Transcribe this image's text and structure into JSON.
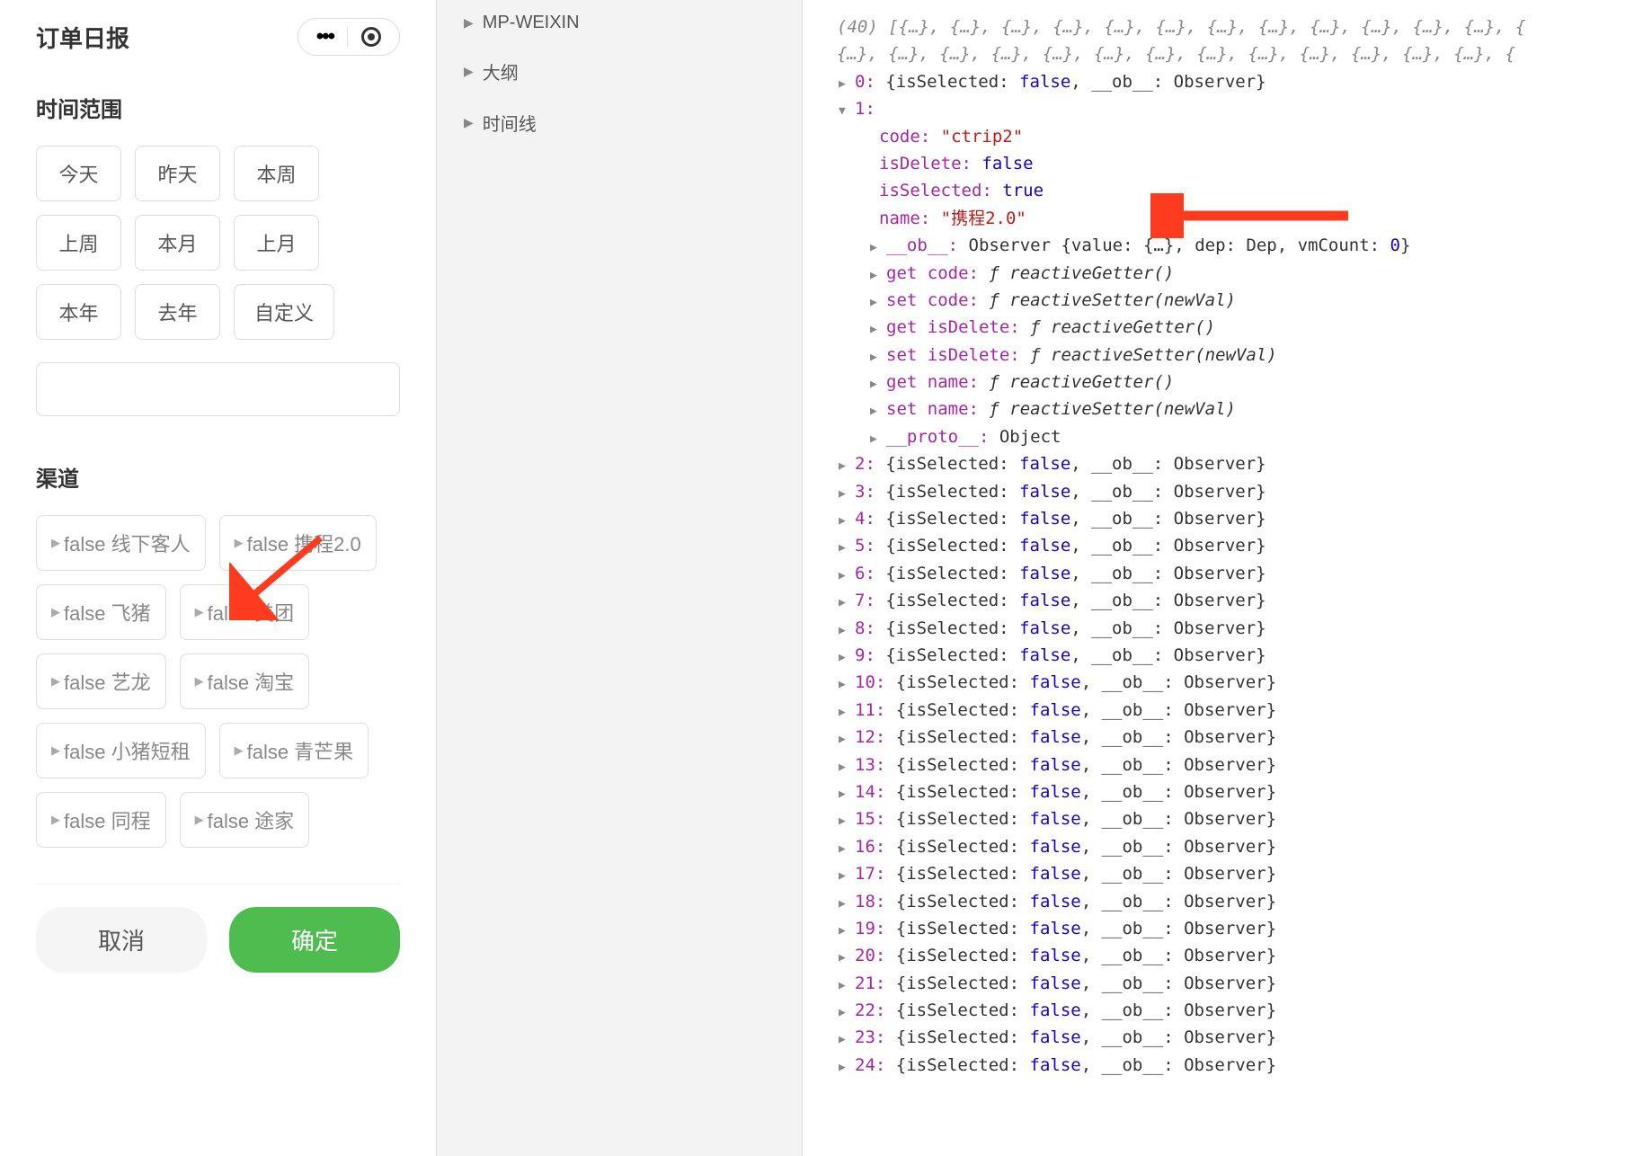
{
  "header": {
    "title": "订单日报"
  },
  "timeRange": {
    "label": "时间范围",
    "buttons": [
      "今天",
      "昨天",
      "本周",
      "上周",
      "本月",
      "上月",
      "本年",
      "去年",
      "自定义"
    ]
  },
  "channel": {
    "label": "渠道",
    "items": [
      {
        "state": "false",
        "name": "线下客人"
      },
      {
        "state": "false",
        "name": "携程2.0"
      },
      {
        "state": "false",
        "name": "飞猪"
      },
      {
        "state": "false",
        "name": "美团"
      },
      {
        "state": "false",
        "name": "艺龙"
      },
      {
        "state": "false",
        "name": "淘宝"
      },
      {
        "state": "false",
        "name": "小猪短租"
      },
      {
        "state": "false",
        "name": "青芒果"
      },
      {
        "state": "false",
        "name": "同程"
      },
      {
        "state": "false",
        "name": "途家"
      }
    ]
  },
  "footer": {
    "cancel": "取消",
    "confirm": "确定"
  },
  "tree": {
    "items": [
      "MP-WEIXIN",
      "大纲",
      "时间线"
    ]
  },
  "console": {
    "summary": "(40) [{…}, {…}, {…}, {…}, {…}, {…}, {…}, {…}, {…}, {…}, {…}, {…}, {",
    "summary2": "{…}, {…}, {…}, {…}, {…}, {…}, {…}, {…}, {…}, {…}, {…}, {…}, {…}, {",
    "item0": {
      "idx": "0:",
      "body": "{isSelected: false, __ob__: Observer}"
    },
    "item1": {
      "idx": "1:",
      "code_key": "code:",
      "code_val": "\"ctrip2\"",
      "isDelete_key": "isDelete:",
      "isDelete_val": "false",
      "isSelected_key": "isSelected:",
      "isSelected_val": "true",
      "name_key": "name:",
      "name_val": "\"携程2.0\"",
      "ob_key": "__ob__:",
      "ob_val": "Observer {value: {…}, dep: Dep, vmCount: 0}",
      "getCode_key": "get code:",
      "getCode_val": "ƒ reactiveGetter()",
      "setCode_key": "set code:",
      "setCode_val": "ƒ reactiveSetter(newVal)",
      "getIsDelete_key": "get isDelete:",
      "getIsDelete_val": "ƒ reactiveGetter()",
      "setIsDelete_key": "set isDelete:",
      "setIsDelete_val": "ƒ reactiveSetter(newVal)",
      "getName_key": "get name:",
      "getName_val": "ƒ reactiveGetter()",
      "setName_key": "set name:",
      "setName_val": "ƒ reactiveSetter(newVal)",
      "proto_key": "__proto__:",
      "proto_val": "Object"
    },
    "rest": [
      {
        "idx": "2:",
        "body": "{isSelected: false, __ob__: Observer}"
      },
      {
        "idx": "3:",
        "body": "{isSelected: false, __ob__: Observer}"
      },
      {
        "idx": "4:",
        "body": "{isSelected: false, __ob__: Observer}"
      },
      {
        "idx": "5:",
        "body": "{isSelected: false, __ob__: Observer}"
      },
      {
        "idx": "6:",
        "body": "{isSelected: false, __ob__: Observer}"
      },
      {
        "idx": "7:",
        "body": "{isSelected: false, __ob__: Observer}"
      },
      {
        "idx": "8:",
        "body": "{isSelected: false, __ob__: Observer}"
      },
      {
        "idx": "9:",
        "body": "{isSelected: false, __ob__: Observer}"
      },
      {
        "idx": "10:",
        "body": "{isSelected: false, __ob__: Observer}"
      },
      {
        "idx": "11:",
        "body": "{isSelected: false, __ob__: Observer}"
      },
      {
        "idx": "12:",
        "body": "{isSelected: false, __ob__: Observer}"
      },
      {
        "idx": "13:",
        "body": "{isSelected: false, __ob__: Observer}"
      },
      {
        "idx": "14:",
        "body": "{isSelected: false, __ob__: Observer}"
      },
      {
        "idx": "15:",
        "body": "{isSelected: false, __ob__: Observer}"
      },
      {
        "idx": "16:",
        "body": "{isSelected: false, __ob__: Observer}"
      },
      {
        "idx": "17:",
        "body": "{isSelected: false, __ob__: Observer}"
      },
      {
        "idx": "18:",
        "body": "{isSelected: false, __ob__: Observer}"
      },
      {
        "idx": "19:",
        "body": "{isSelected: false, __ob__: Observer}"
      },
      {
        "idx": "20:",
        "body": "{isSelected: false, __ob__: Observer}"
      },
      {
        "idx": "21:",
        "body": "{isSelected: false, __ob__: Observer}"
      },
      {
        "idx": "22:",
        "body": "{isSelected: false, __ob__: Observer}"
      },
      {
        "idx": "23:",
        "body": "{isSelected: false, __ob__: Observer}"
      },
      {
        "idx": "24:",
        "body": "{isSelected: false, __ob__: Observer}"
      }
    ]
  }
}
